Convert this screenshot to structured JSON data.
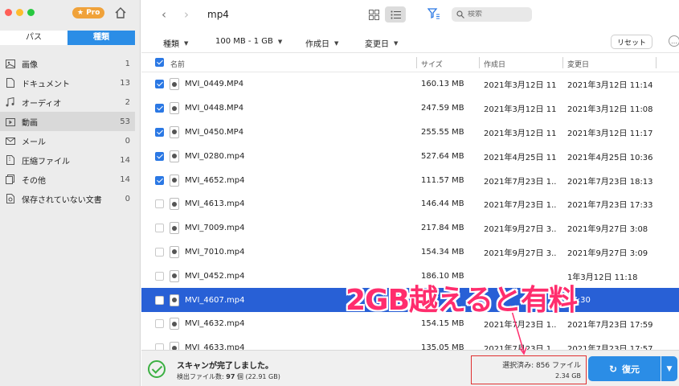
{
  "window": {
    "title": "mp4",
    "pro_badge": "Pro"
  },
  "sidebar": {
    "segment": {
      "path_label": "パス",
      "type_label": "種類"
    },
    "items": [
      {
        "label": "画像",
        "count": "1",
        "icon": "image-icon"
      },
      {
        "label": "ドキュメント",
        "count": "13",
        "icon": "document-icon"
      },
      {
        "label": "オーディオ",
        "count": "2",
        "icon": "music-icon"
      },
      {
        "label": "動画",
        "count": "53",
        "icon": "video-icon"
      },
      {
        "label": "メール",
        "count": "0",
        "icon": "mail-icon"
      },
      {
        "label": "圧縮ファイル",
        "count": "14",
        "icon": "archive-icon"
      },
      {
        "label": "その他",
        "count": "14",
        "icon": "other-icon"
      },
      {
        "label": "保存されていない文書",
        "count": "0",
        "icon": "unsaved-document-icon"
      }
    ]
  },
  "toolbar": {
    "search_placeholder": "検索"
  },
  "filters": {
    "type": "種類",
    "size": "100 MB - 1 GB",
    "created": "作成日",
    "modified": "変更日",
    "reset": "リセット",
    "more": "…"
  },
  "table": {
    "headers": {
      "name": "名前",
      "size": "サイズ",
      "created": "作成日",
      "modified": "変更日"
    },
    "rows": [
      {
        "name": "MVI_0449.MP4",
        "size": "160.13 MB",
        "created": "2021年3月12日 11...",
        "modified": "2021年3月12日 11:14",
        "checked": true
      },
      {
        "name": "MVI_0448.MP4",
        "size": "247.59 MB",
        "created": "2021年3月12日 11...",
        "modified": "2021年3月12日 11:08",
        "checked": true
      },
      {
        "name": "MVI_0450.MP4",
        "size": "255.55 MB",
        "created": "2021年3月12日 11...",
        "modified": "2021年3月12日 11:17",
        "checked": true
      },
      {
        "name": "MVI_0280.mp4",
        "size": "527.64 MB",
        "created": "2021年4月25日 11...",
        "modified": "2021年4月25日 10:36",
        "checked": true
      },
      {
        "name": "MVI_4652.mp4",
        "size": "111.57 MB",
        "created": "2021年7月23日 1...",
        "modified": "2021年7月23日 18:13",
        "checked": true
      },
      {
        "name": "MVI_4613.mp4",
        "size": "146.44 MB",
        "created": "2021年7月23日 1...",
        "modified": "2021年7月23日 17:33",
        "checked": false
      },
      {
        "name": "MVI_7009.mp4",
        "size": "217.84 MB",
        "created": "2021年9月27日 3...",
        "modified": "2021年9月27日 3:08",
        "checked": false
      },
      {
        "name": "MVI_7010.mp4",
        "size": "154.34 MB",
        "created": "2021年9月27日 3...",
        "modified": "2021年9月27日 3:09",
        "checked": false
      },
      {
        "name": "MVI_0452.mp4",
        "size": "186.10 MB",
        "created": "",
        "modified": "1年3月12日 11:18",
        "checked": false
      },
      {
        "name": "MVI_4607.mp4",
        "size": "",
        "created": "",
        "modified": "17:30",
        "checked": false
      },
      {
        "name": "MVI_4632.mp4",
        "size": "154.15 MB",
        "created": "2021年7月23日 1...",
        "modified": "2021年7月23日 17:59",
        "checked": false
      },
      {
        "name": "MVI_4633.mp4",
        "size": "135.05 MB",
        "created": "2021年7月23日 1...",
        "modified": "2021年7月23日 17:57",
        "checked": false
      }
    ]
  },
  "status": {
    "scan_done": "スキャンが完了しました。",
    "detected_prefix": "検出ファイル数: ",
    "detected_count": "97",
    "detected_suffix": " 個 (22.91 GB)",
    "selected_count": "選択済み: 856 ファイル",
    "selected_size": "2.34 GB",
    "restore_label": "復元"
  },
  "annotation": {
    "text": "2GB越えると有料",
    "color": "#ff2d6d"
  },
  "colors": {
    "accent": "#2b8de6",
    "selection_row": "#2860d6",
    "checkbox": "#2b78e4",
    "pro_badge": "#f0a23a",
    "success": "#3cb043",
    "highlight_box": "#e03030"
  }
}
